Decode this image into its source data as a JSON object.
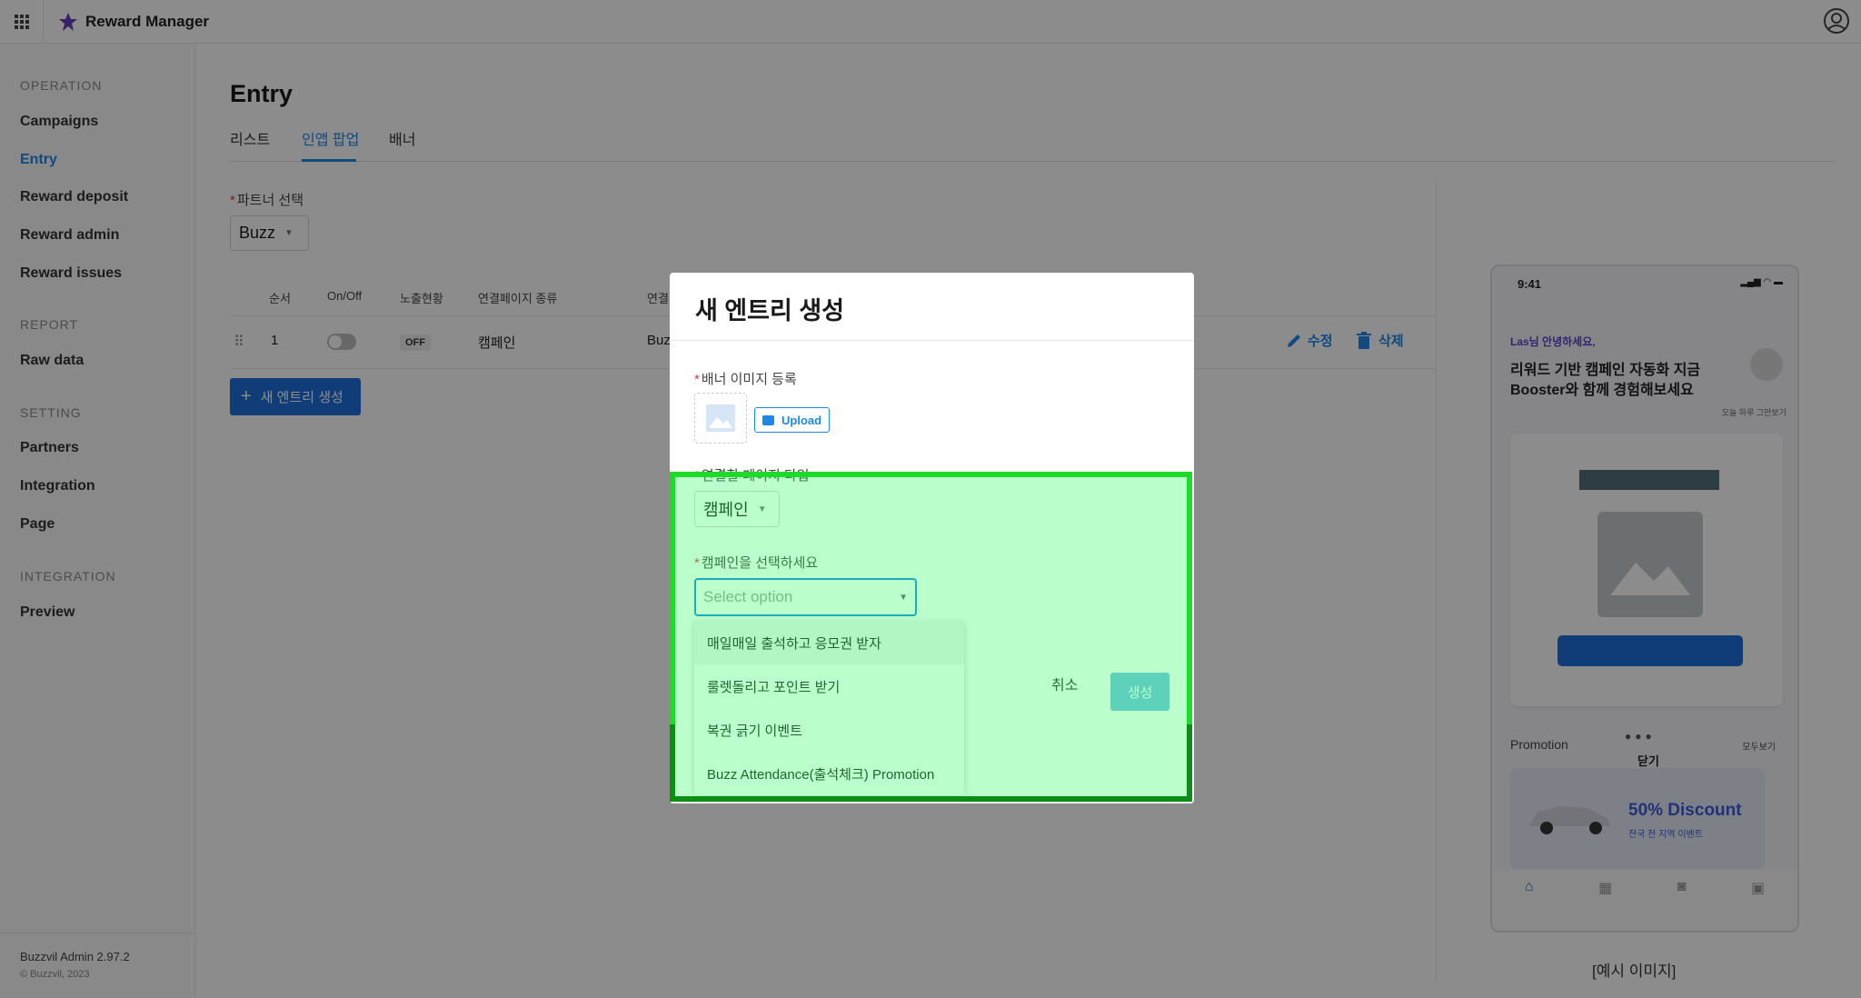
{
  "app": {
    "title": "Reward Manager"
  },
  "sidebar": {
    "sections": [
      {
        "title": "OPERATION",
        "items": [
          "Campaigns",
          "Entry",
          "Reward deposit",
          "Reward admin",
          "Reward issues"
        ]
      },
      {
        "title": "REPORT",
        "items": [
          "Raw data"
        ]
      },
      {
        "title": "SETTING",
        "items": [
          "Partners",
          "Integration",
          "Page"
        ]
      },
      {
        "title": "INTEGRATION",
        "items": [
          "Preview"
        ]
      }
    ],
    "active_item": "Entry",
    "footer": {
      "version": "Buzzvil Admin 2.97.2",
      "copyright": "© Buzzvil, 2023"
    }
  },
  "main": {
    "title": "Entry",
    "tabs": [
      {
        "label": "리스트",
        "active": false
      },
      {
        "label": "인앱 팝업",
        "active": true
      },
      {
        "label": "배너",
        "active": false
      }
    ],
    "partner_label": "파트너 선택",
    "partner_value": "Buzz",
    "table": {
      "headers": [
        "순서",
        "On/Off",
        "노출현황",
        "연결페이지 종류",
        "연결"
      ],
      "rows": [
        {
          "order": "1",
          "on_off": "off",
          "status": "OFF",
          "page_type": "캠페인",
          "link": "Buz",
          "edit": "수정",
          "delete": "삭제"
        }
      ]
    },
    "new_entry_button": "새 엔트리 생성"
  },
  "preview": {
    "time": "9:41",
    "greeting": "Las님 안녕하세요,",
    "headline": "리워드 기반 캠페인 자동화 지금 Booster와 함께 경험해보세요",
    "not_today": "오늘 하루 그만보기",
    "close": "닫기",
    "promotion": "Promotion",
    "see_all": "모두보기",
    "discount": "50% Discount",
    "discount_sub": "전국 전 지역 이벤트",
    "caption": "[예시 이미지]"
  },
  "modal": {
    "title": "새 엔트리 생성",
    "banner_label": "배너 이미지 등록",
    "upload_label": "Upload",
    "page_type_label": "연결할 페이지 타입",
    "page_type_value": "캠페인",
    "campaign_label": "캠페인을 선택하세요",
    "campaign_placeholder": "Select option",
    "cancel": "취소",
    "create": "생성",
    "options": [
      "매일매일 출석하고 응모권 받자",
      "룰렛돌리고 포인트 받기",
      "복권 긁기 이벤트",
      "Buzz Attendance(출석체크) Promotion"
    ]
  },
  "colors": {
    "accent": "#1e88e5",
    "primary_button": "#1e6fd9",
    "highlight": "#1edb2a"
  }
}
